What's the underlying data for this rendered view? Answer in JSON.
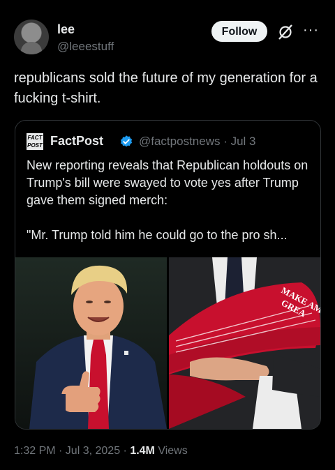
{
  "author": {
    "name": "lee",
    "handle": "@leeestuff"
  },
  "actions": {
    "follow_label": "Follow",
    "more_label": "···"
  },
  "tweet": {
    "text": "republicans sold the future of my generation for a fucking t-shirt."
  },
  "quoted": {
    "logo_text_top": "FACT",
    "logo_text_bottom": "POST",
    "name": "FactPost",
    "handle_and_date": "@factpostnews · Jul 3",
    "paragraph1": "New reporting reveals that Republican holdouts on Trump's bill were swayed to vote yes after Trump gave them signed merch:",
    "paragraph2": "\"Mr. Trump told him he could go to the pro sh...",
    "hat_text_top": "MAKE AM",
    "hat_text_bottom": "GREA"
  },
  "meta": {
    "time_date": "1:32 PM · Jul 3, 2025 · ",
    "views_count": "1.4M",
    "views_label": " Views"
  },
  "colors": {
    "background": "#000000",
    "text": "#e7e9ea",
    "muted": "#71767b",
    "border": "#2f3336",
    "verified": "#1d9bf0",
    "hat_red": "#c8102e"
  },
  "icons": [
    "grok-icon",
    "more-icon",
    "verified-icon"
  ]
}
